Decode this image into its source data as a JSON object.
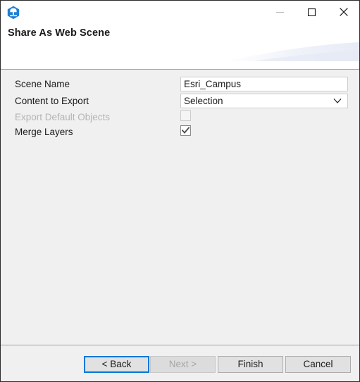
{
  "window": {
    "app_icon_name": "arcgis-pro-app-icon",
    "controls": {
      "minimize_label": "—",
      "minimize_name": "minimize-button",
      "maximize_label": "□",
      "maximize_name": "maximize-button",
      "close_label": "✕",
      "close_name": "close-button"
    }
  },
  "header": {
    "title": "Share As Web Scene"
  },
  "form": {
    "rows": [
      {
        "label": "Scene Name",
        "type": "text",
        "value": "Esri_Campus",
        "placeholder": "",
        "disabled": false
      },
      {
        "label": "Content to Export",
        "type": "select",
        "value": "Selection",
        "disabled": false
      },
      {
        "label": "Export Default Objects",
        "type": "checkbox",
        "checked": false,
        "disabled": true
      },
      {
        "label": "Merge Layers",
        "type": "checkbox",
        "checked": true,
        "disabled": false
      }
    ]
  },
  "footer": {
    "buttons": [
      {
        "label": "< Back",
        "name": "back-button",
        "state": "focused"
      },
      {
        "label": "Next >",
        "name": "next-button",
        "state": "disabled"
      },
      {
        "label": "Finish",
        "name": "finish-button",
        "state": "normal"
      },
      {
        "label": "Cancel",
        "name": "cancel-button",
        "state": "normal"
      }
    ]
  },
  "colors": {
    "accent": "#0078d7",
    "dialog_bg": "#f0f0f0",
    "header_bg": "#ffffff",
    "icon_blue": "#1d7fd6",
    "disabled_text": "#b4b4b4",
    "text": "#1b1b1b"
  }
}
